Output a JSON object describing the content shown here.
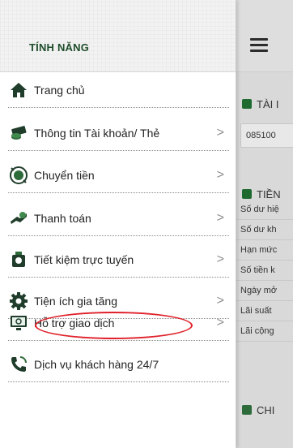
{
  "drawer": {
    "title": "TÍNH NĂNG",
    "items": [
      {
        "label": "Trang chủ",
        "chevron": false,
        "icon": "home-icon"
      },
      {
        "label": "Thông tin Tài khoản/ Thẻ",
        "chevron": true,
        "icon": "card-icon"
      },
      {
        "label": "Chuyển tiền",
        "chevron": true,
        "icon": "transfer-icon"
      },
      {
        "label": "Thanh toán",
        "chevron": true,
        "icon": "payment-icon"
      },
      {
        "label": "Tiết kiệm trực tuyến",
        "chevron": true,
        "icon": "piggy-bank-icon"
      },
      {
        "label": "Tiện ích gia tăng",
        "chevron": true,
        "icon": "gear-icon"
      },
      {
        "label": "Hỗ trợ giao dịch",
        "chevron": true,
        "icon": "support-icon"
      },
      {
        "label": "Dịch vụ khách hàng 24/7",
        "chevron": false,
        "icon": "phone-icon"
      }
    ],
    "chevron_glyph": ">"
  },
  "background": {
    "account_section_title": "TÀI I",
    "account_number": "085100",
    "savings_section_title": "TIỀN",
    "rows": [
      "Số dư hiệ",
      "Số dư kh",
      "Hạn mức",
      "Số tiền k",
      "Ngày mở",
      "Lãi suất",
      "Lãi cộng"
    ],
    "bottom_section_title": "CHI"
  },
  "colors": {
    "brand_green": "#1e4d2b",
    "highlight_red": "#e0212a"
  }
}
